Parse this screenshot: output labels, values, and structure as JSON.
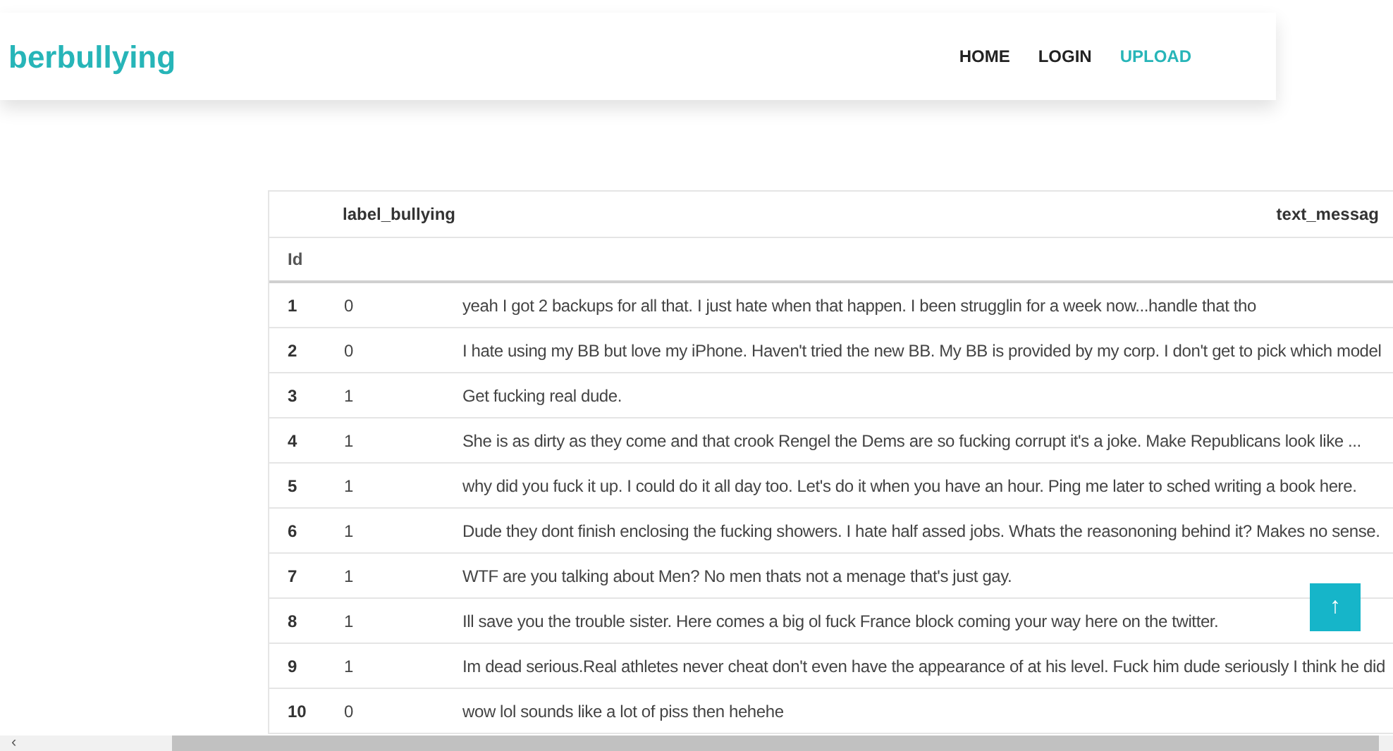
{
  "navbar": {
    "brand": "berbullying",
    "links": [
      {
        "label": "HOME",
        "selected": false
      },
      {
        "label": "LOGIN",
        "selected": false
      },
      {
        "label": "UPLOAD",
        "selected": true
      }
    ]
  },
  "table": {
    "columns": [
      "label_bullying",
      "text_messag"
    ],
    "index_name": "Id",
    "rows": [
      {
        "id": "1",
        "label_bullying": "0",
        "text_message": "yeah I got 2 backups for all that. I just hate when that happen. I been strugglin for a week now...handle that tho"
      },
      {
        "id": "2",
        "label_bullying": "0",
        "text_message": "I hate using my BB but love my iPhone. Haven't tried the new BB. My BB is provided by my corp. I don't get to pick which model"
      },
      {
        "id": "3",
        "label_bullying": "1",
        "text_message": "Get fucking real dude."
      },
      {
        "id": "4",
        "label_bullying": "1",
        "text_message": "She is as dirty as they come and that crook Rengel the Dems are so fucking corrupt it's a joke. Make Republicans look like ..."
      },
      {
        "id": "5",
        "label_bullying": "1",
        "text_message": "why did you fuck it up. I could do it all day too. Let's do it when you have an hour. Ping me later to sched writing a book here."
      },
      {
        "id": "6",
        "label_bullying": "1",
        "text_message": "Dude they dont finish enclosing the fucking showers. I hate half assed jobs. Whats the reasononing behind it? Makes no sense."
      },
      {
        "id": "7",
        "label_bullying": "1",
        "text_message": "WTF are you talking about Men? No men thats not a menage that's just gay."
      },
      {
        "id": "8",
        "label_bullying": "1",
        "text_message": "Ill save you the trouble sister. Here comes a big ol fuck France block coming your way here on the twitter."
      },
      {
        "id": "9",
        "label_bullying": "1",
        "text_message": "Im dead serious.Real athletes never cheat don't even have the appearance of at his level. Fuck him dude seriously I think he did"
      },
      {
        "id": "10",
        "label_bullying": "0",
        "text_message": "wow lol sounds like a lot of piss then hehehe"
      }
    ]
  },
  "scroll_top_button": {
    "label": "↑"
  },
  "scrollbar": {
    "left_arrow": "‹"
  }
}
